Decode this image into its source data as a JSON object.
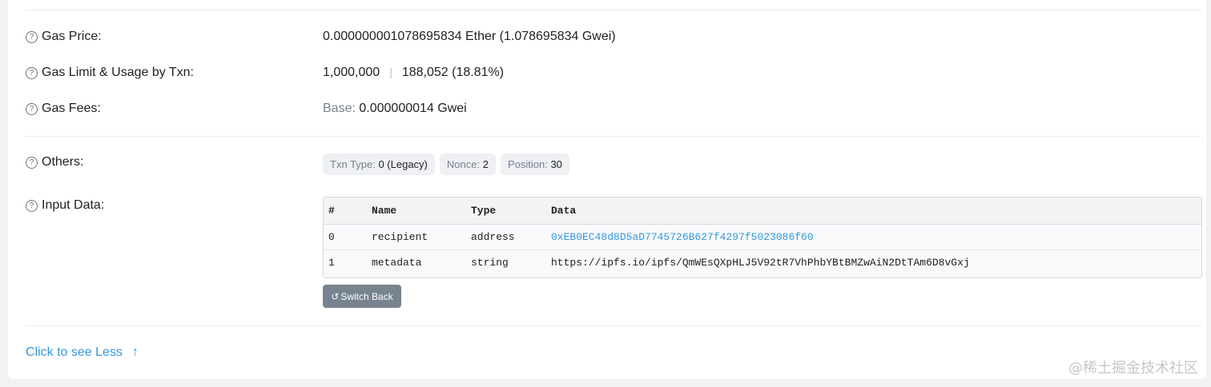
{
  "gas_price": {
    "label": "Gas Price:",
    "value": "0.000000001078695834 Ether (1.078695834 Gwei)"
  },
  "gas_limit": {
    "label": "Gas Limit & Usage by Txn:",
    "limit": "1,000,000",
    "separator": "|",
    "usage": "188,052 (18.81%)"
  },
  "gas_fees": {
    "label": "Gas Fees:",
    "base_label": "Base:",
    "base_value": "0.000000014 Gwei"
  },
  "others": {
    "label": "Others:",
    "txn_type_label": "Txn Type:",
    "txn_type_value": "0 (Legacy)",
    "nonce_label": "Nonce:",
    "nonce_value": "2",
    "position_label": "Position:",
    "position_value": "30"
  },
  "input_data": {
    "label": "Input Data:",
    "headers": [
      "#",
      "Name",
      "Type",
      "Data"
    ],
    "rows": [
      {
        "index": "0",
        "name": "recipient",
        "type": "address",
        "data": "0xEB0EC48d8D5aD7745726B627f4297f5023086f60"
      },
      {
        "index": "1",
        "name": "metadata",
        "type": "string",
        "data": "https://ipfs.io/ipfs/QmWEsQXpHLJ5V92tR7VhPhbYBtBMZwAiN2DtTAm6D8vGxj"
      }
    ],
    "switch_back_label": "Switch Back"
  },
  "toggle": {
    "label": "Click to see Less"
  },
  "watermark": "@稀土掘金技术社区",
  "icons": {
    "help": "question-circle-icon",
    "undo": "undo-icon",
    "arrow_up": "arrow-up-icon"
  },
  "colors": {
    "link": "#3498db",
    "button": "#77838f",
    "muted": "#77838f"
  }
}
